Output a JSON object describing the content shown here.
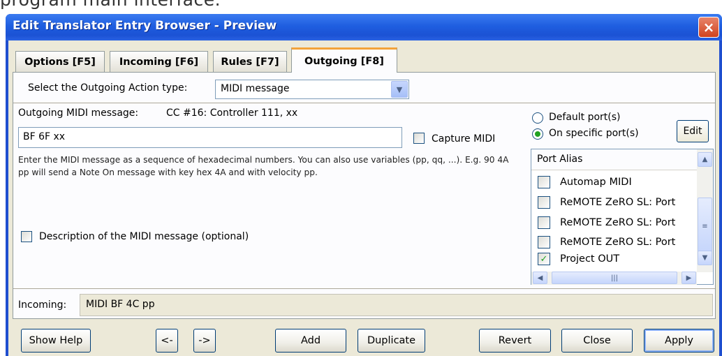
{
  "page_fragment": "program main interface.",
  "window": {
    "title": "Edit Translator Entry Browser - Preview",
    "close_glyph": "×"
  },
  "tabs": [
    {
      "label": "Options [F5]"
    },
    {
      "label": "Incoming [F6]"
    },
    {
      "label": "Rules [F7]"
    },
    {
      "label": "Outgoing [F8]",
      "active": true
    }
  ],
  "outgoing": {
    "action_label": "Select the Outgoing Action type:",
    "action_value": "MIDI message",
    "midi_label": "Outgoing MIDI message:",
    "midi_description": "CC #16: Controller 111, xx",
    "midi_value": "BF 6F xx",
    "capture_label": "Capture MIDI",
    "capture_checked": false,
    "help_text": "Enter the MIDI message as a sequence of hexadecimal numbers. You can also use variables (pp, qq, ...). E.g. 90 4A pp will send a Note On message with key hex 4A and with velocity pp.",
    "description_label": "Description of the MIDI message (optional)",
    "description_checked": false
  },
  "ports": {
    "default_label": "Default port(s)",
    "specific_label": "On specific port(s)",
    "selected": "specific",
    "edit_label": "Edit",
    "column_header": "Port Alias",
    "items": [
      {
        "label": "Automap MIDI",
        "checked": false
      },
      {
        "label": "ReMOTE ZeRO SL: Port",
        "checked": false
      },
      {
        "label": "ReMOTE ZeRO SL: Port",
        "checked": false
      },
      {
        "label": "ReMOTE ZeRO SL: Port",
        "checked": false
      },
      {
        "label": "Project OUT",
        "checked": true
      }
    ]
  },
  "incoming": {
    "label": "Incoming:",
    "value": "MIDI BF 4C pp"
  },
  "buttons": {
    "show_help": "Show Help",
    "prev": "<-",
    "next": "->",
    "add": "Add",
    "duplicate": "Duplicate",
    "revert": "Revert",
    "close": "Close",
    "apply": "Apply"
  },
  "colors": {
    "title_bar": "#1f5ee0",
    "dialog_bg": "#ece9d8",
    "active_tab_accent": "#f3a33a",
    "check_green": "#21a121",
    "close_red": "#d0431f"
  }
}
